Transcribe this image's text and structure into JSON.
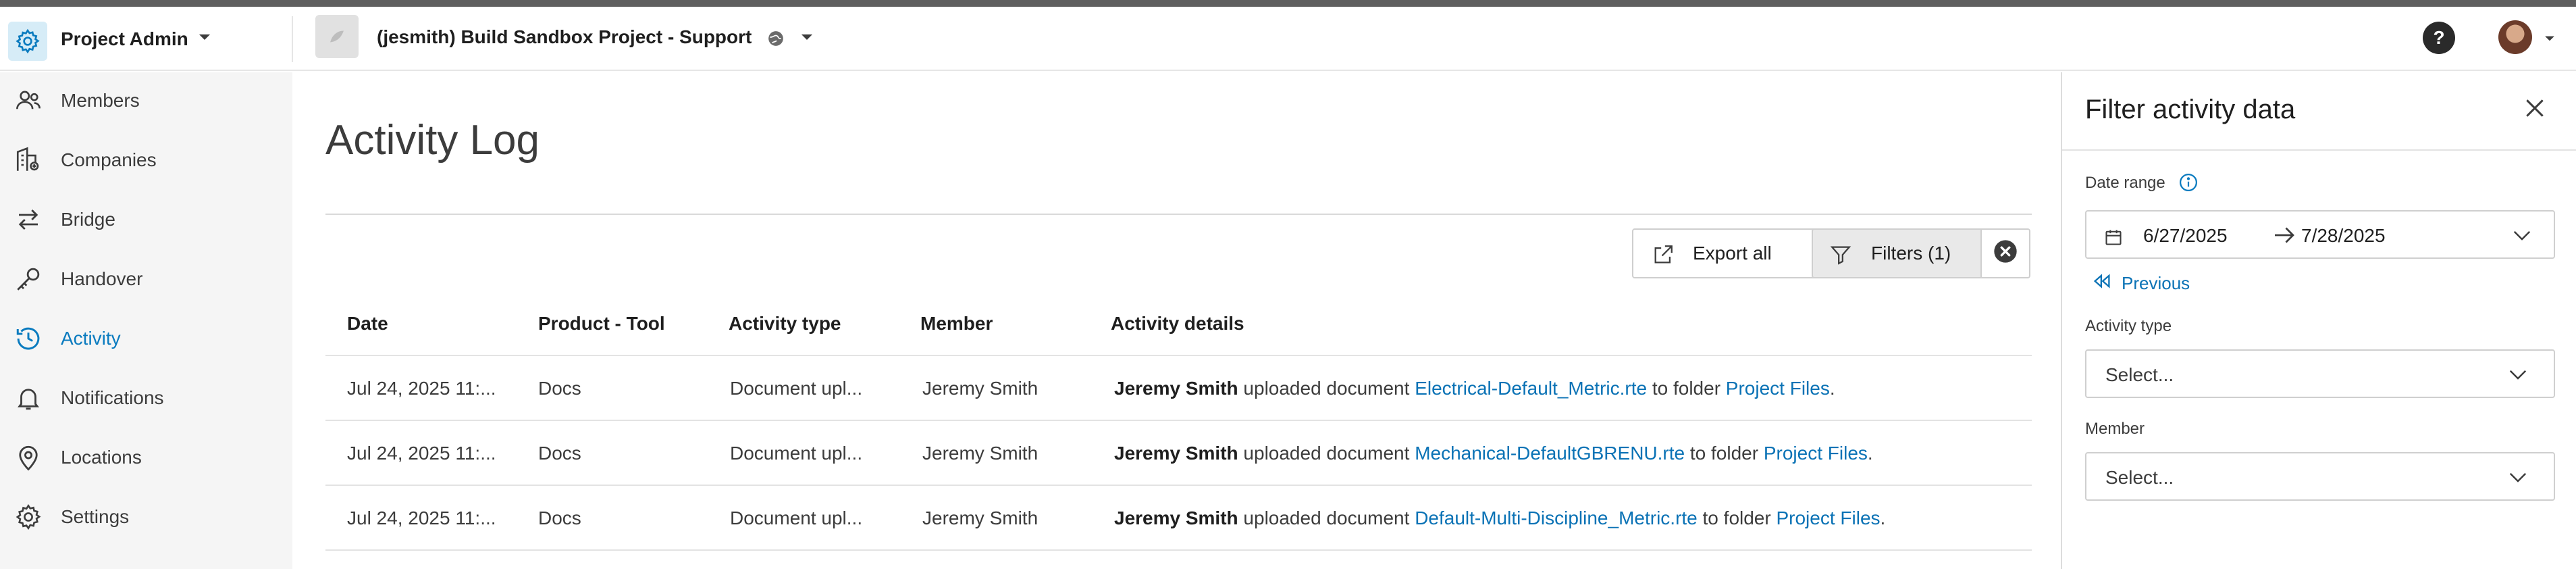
{
  "header": {
    "app_title": "Project Admin",
    "project_title": "(jesmith) Build Sandbox Project - Support",
    "help_label": "?"
  },
  "sidebar": {
    "items": [
      {
        "label": "Members",
        "icon": "members-icon"
      },
      {
        "label": "Companies",
        "icon": "companies-icon"
      },
      {
        "label": "Bridge",
        "icon": "bridge-icon"
      },
      {
        "label": "Handover",
        "icon": "handover-icon"
      },
      {
        "label": "Activity",
        "icon": "activity-icon",
        "active": true
      },
      {
        "label": "Notifications",
        "icon": "bell-icon"
      },
      {
        "label": "Locations",
        "icon": "location-pin-icon"
      },
      {
        "label": "Settings",
        "icon": "gear-icon"
      }
    ]
  },
  "main": {
    "title": "Activity Log",
    "export_label": "Export all",
    "filters_label": "Filters (1)",
    "columns": [
      "Date",
      "Product - Tool",
      "Activity type",
      "Member",
      "Activity details"
    ],
    "rows": [
      {
        "date": "Jul 24, 2025 11:...",
        "product": "Docs",
        "type": "Document upl...",
        "member": "Jeremy Smith",
        "actor": "Jeremy Smith",
        "action": "uploaded document",
        "document": "Electrical-Default_Metric.rte",
        "to_folder": "to folder",
        "folder": "Project Files",
        "end": "."
      },
      {
        "date": "Jul 24, 2025 11:...",
        "product": "Docs",
        "type": "Document upl...",
        "member": "Jeremy Smith",
        "actor": "Jeremy Smith",
        "action": "uploaded document",
        "document": "Mechanical-DefaultGBRENU.rte",
        "to_folder": "to folder",
        "folder": "Project Files",
        "end": "."
      },
      {
        "date": "Jul 24, 2025 11:...",
        "product": "Docs",
        "type": "Document upl...",
        "member": "Jeremy Smith",
        "actor": "Jeremy Smith",
        "action": "uploaded document",
        "document": "Default-Multi-Discipline_Metric.rte",
        "to_folder": "to folder",
        "folder": "Project Files",
        "end": "."
      }
    ]
  },
  "panel": {
    "title": "Filter activity data",
    "date_range_label": "Date range",
    "date_from": "6/27/2025",
    "date_to": "7/28/2025",
    "previous_label": "Previous",
    "activity_type_label": "Activity type",
    "activity_type_placeholder": "Select...",
    "member_label": "Member",
    "member_placeholder": "Select..."
  },
  "colors": {
    "accent": "#0a7bbf",
    "link": "#0a72b5",
    "sidebar_bg": "#f5f5f5",
    "app_icon_bg": "#d6ecf7"
  }
}
